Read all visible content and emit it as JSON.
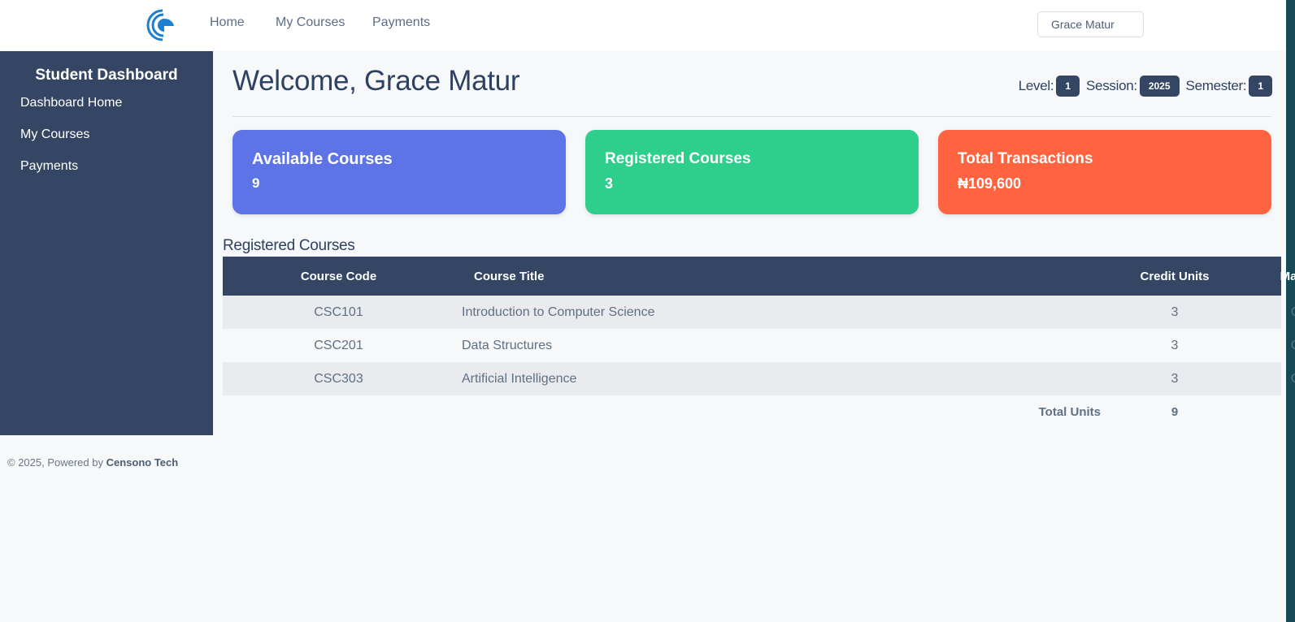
{
  "nav": {
    "links": [
      "Home",
      "My Courses",
      "Payments"
    ],
    "user_name": "Grace Matur"
  },
  "sidebar": {
    "title": "Student Dashboard",
    "items": [
      "Dashboard Home",
      "My Courses",
      "Payments"
    ]
  },
  "main": {
    "welcome": "Welcome, Grace Matur",
    "meta": {
      "level_label": "Level:",
      "level_value": "1",
      "session_label": "Session:",
      "session_value": "2025",
      "semester_label": "Semester:",
      "semester_value": "1"
    },
    "cards": [
      {
        "title": "Available Courses",
        "value": "9",
        "color": "#5e73e5"
      },
      {
        "title": "Registered Courses",
        "value": "3",
        "color": "#2ecf8d"
      },
      {
        "title": "Total Transactions",
        "value": "₦109,600",
        "color": "#ff633f"
      }
    ],
    "section_title": "Registered Courses",
    "table": {
      "headers": [
        "Course Code",
        "Course Title",
        "Credit Units",
        "Mandate"
      ],
      "rows": [
        [
          "CSC101",
          "Introduction to Computer Science",
          "3",
          "Core"
        ],
        [
          "CSC201",
          "Data Structures",
          "3",
          "Core"
        ],
        [
          "CSC303",
          "Artificial Intelligence",
          "3",
          "Core"
        ]
      ],
      "total_label": "Total Units",
      "total_value": "9"
    }
  },
  "footer": {
    "prefix": "© 2025, Powered by",
    "brand": "Censono Tech"
  },
  "colors": {
    "sidebar": "#344664",
    "accent": "#1d7fcf"
  }
}
